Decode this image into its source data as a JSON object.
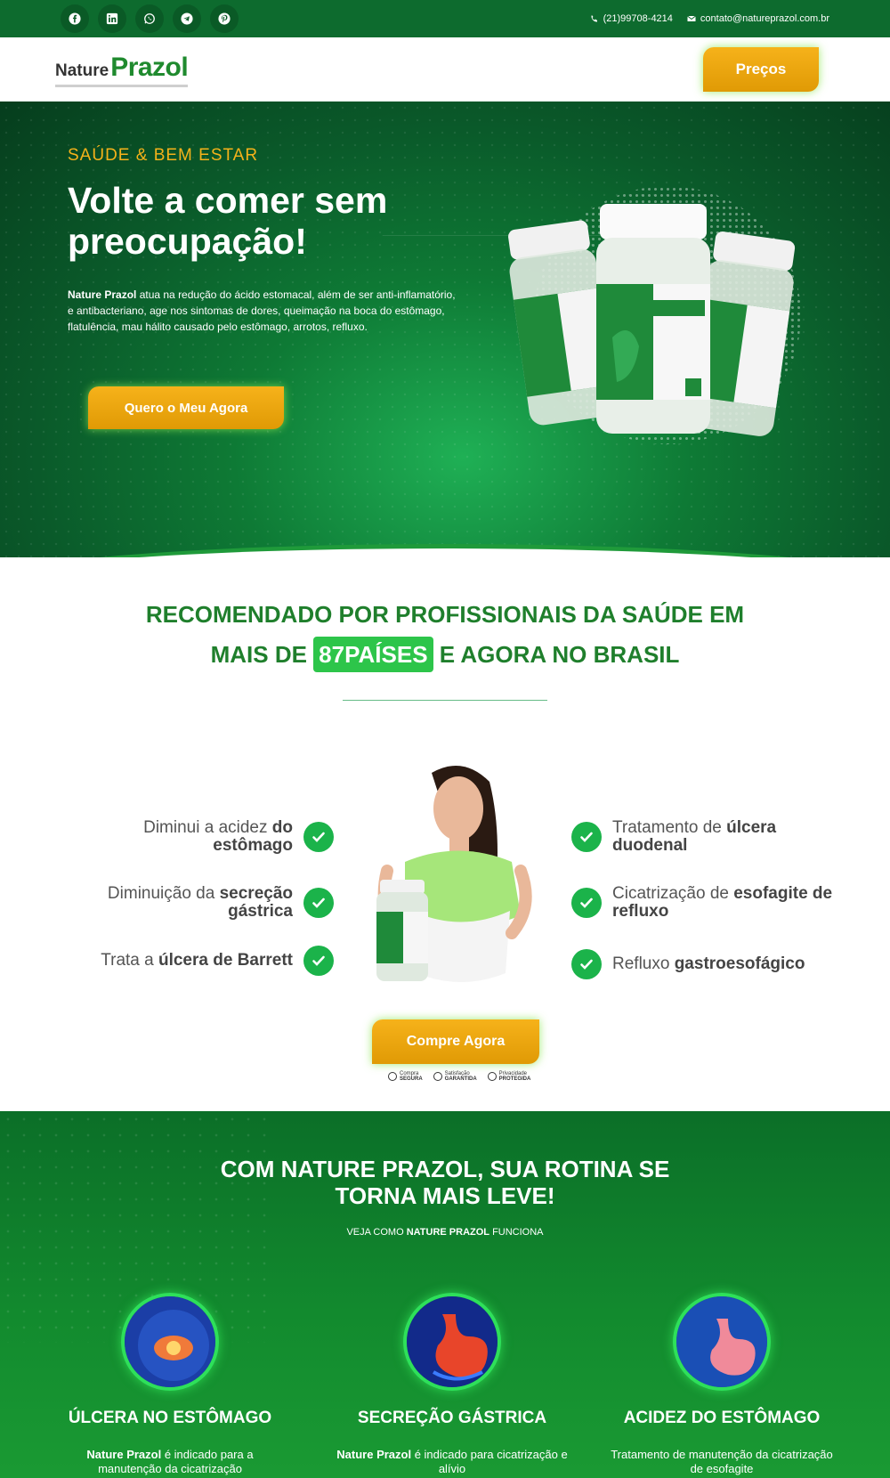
{
  "topbar": {
    "socials": [
      "facebook-icon",
      "linkedin-icon",
      "whatsapp-icon",
      "telegram-icon",
      "pinterest-icon"
    ],
    "phone": "(21)99708-4214",
    "email": "contato@natureprazol.com.br"
  },
  "header": {
    "logo_prefix": "Nature",
    "logo_main": "Prazol",
    "precos_label": "Preços"
  },
  "hero": {
    "kicker": "SAÚDE & BEM ESTAR",
    "title": "Volte a comer sem preocupação!",
    "text_brand": "Nature Prazol",
    "text_body": " atua na redução do ácido estomacal, além de ser anti-inflamatório, e antibacteriano, age nos sintomas de dores, queimação na boca do estômago, flatulência, mau hálito causado pelo estômago, arrotos, refluxo.",
    "cta_label": "Quero o Meu Agora"
  },
  "recommended": {
    "line1": "RECOMENDADO POR PROFISSIONAIS DA SAÚDE EM",
    "line2_prefix": "MAIS DE ",
    "highlight": "87PAÍSES",
    "line2_suffix": " E AGORA NO BRASIL"
  },
  "benefits": {
    "left": [
      {
        "normal": "Diminui a acidez ",
        "bold": "do estômago"
      },
      {
        "normal": "Diminuição da ",
        "bold": "secreção gástrica"
      },
      {
        "normal": "Trata a ",
        "bold": "úlcera de Barrett"
      }
    ],
    "right": [
      {
        "normal": "Tratamento de ",
        "bold": "úlcera duodenal"
      },
      {
        "normal": "Cicatrização de ",
        "bold": "esofagite de refluxo"
      },
      {
        "normal": "Refluxo ",
        "bold": "gastroesofágico"
      }
    ]
  },
  "cta": {
    "label": "Compre Agora",
    "trust": [
      {
        "top": "Compra",
        "bottom": "SEGURA"
      },
      {
        "top": "Satisfação",
        "bottom": "GARANTIDA"
      },
      {
        "top": "Privacidade",
        "bottom": "PROTEGIDA"
      }
    ]
  },
  "how": {
    "title": "COM NATURE PRAZOL, SUA ROTINA SE TORNA MAIS LEVE!",
    "sub_prefix": "VEJA COMO ",
    "sub_brand": "NATURE PRAZOL",
    "sub_suffix": " FUNCIONA",
    "cards": [
      {
        "title": "ÚLCERA NO ESTÔMAGO",
        "brand": "Nature Prazol",
        "text": " é indicado para a manutenção da cicatrização"
      },
      {
        "title": "SECREÇÃO GÁSTRICA",
        "brand": "Nature Prazol",
        "text": " é indicado para cicatrização e alívio"
      },
      {
        "title": "ACIDEZ DO ESTÔMAGO",
        "brand": "",
        "text": "Tratamento de manutenção da cicatrização de esofagite"
      }
    ]
  },
  "colors": {
    "brand_green": "#0d6b2e",
    "accent_orange": "#f2a60d",
    "check_green": "#1bb34a"
  }
}
